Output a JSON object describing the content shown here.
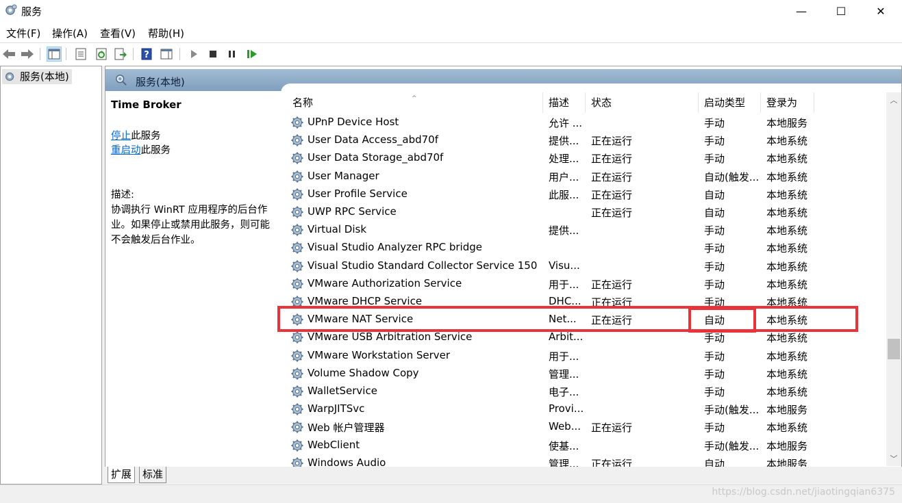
{
  "window": {
    "title": "服务",
    "minimize": "—",
    "maximize": "☐",
    "close": "✕"
  },
  "menu": [
    "文件(F)",
    "操作(A)",
    "查看(V)",
    "帮助(H)"
  ],
  "toolbar": [
    "back-arrow-icon",
    "forward-arrow-icon",
    "show-hide-tree-icon",
    "properties-icon",
    "refresh-icon",
    "export-list-icon",
    "help-icon",
    "action-pane-icon",
    "start-service-icon",
    "stop-service-icon",
    "pause-service-icon",
    "restart-service-icon"
  ],
  "tree": {
    "root": "服务(本地)"
  },
  "header": {
    "title": "服务(本地)"
  },
  "detail": {
    "service_name": "Time Broker",
    "stop_link": "停止",
    "stop_suffix": "此服务",
    "restart_link": "重启动",
    "restart_suffix": "此服务",
    "desc_label": "描述:",
    "desc_lines": [
      "协调执行 WinRT 应用程序的后台作",
      "业。如果停止或禁用此服务，则可能",
      "不会触发后台作业。"
    ]
  },
  "columns": {
    "name": "名称",
    "desc": "描述",
    "status": "状态",
    "startup": "启动类型",
    "logon": "登录为"
  },
  "services": [
    {
      "name": "UPnP Device Host",
      "desc": "允许 ...",
      "status": "",
      "startup": "手动",
      "logon": "本地服务"
    },
    {
      "name": "User Data Access_abd70f",
      "desc": "提供...",
      "status": "正在运行",
      "startup": "手动",
      "logon": "本地系统"
    },
    {
      "name": "User Data Storage_abd70f",
      "desc": "处理...",
      "status": "正在运行",
      "startup": "手动",
      "logon": "本地系统"
    },
    {
      "name": "User Manager",
      "desc": "用户...",
      "status": "正在运行",
      "startup": "自动(触发...",
      "logon": "本地系统"
    },
    {
      "name": "User Profile Service",
      "desc": "此服...",
      "status": "正在运行",
      "startup": "自动",
      "logon": "本地系统"
    },
    {
      "name": "UWP RPC Service",
      "desc": "",
      "status": "正在运行",
      "startup": "自动",
      "logon": "本地系统"
    },
    {
      "name": "Virtual Disk",
      "desc": "提供...",
      "status": "",
      "startup": "手动",
      "logon": "本地系统"
    },
    {
      "name": "Visual Studio Analyzer RPC bridge",
      "desc": "",
      "status": "",
      "startup": "手动",
      "logon": "本地系统"
    },
    {
      "name": "Visual Studio Standard Collector Service 150",
      "desc": "Visu...",
      "status": "",
      "startup": "手动",
      "logon": "本地系统"
    },
    {
      "name": "VMware Authorization Service",
      "desc": "用于...",
      "status": "正在运行",
      "startup": "手动",
      "logon": "本地系统"
    },
    {
      "name": "VMware DHCP Service",
      "desc": "DHC...",
      "status": "正在运行",
      "startup": "手动",
      "logon": "本地系统"
    },
    {
      "name": "VMware NAT Service",
      "desc": "Net...",
      "status": "正在运行",
      "startup": "自动",
      "logon": "本地系统"
    },
    {
      "name": "VMware USB Arbitration Service",
      "desc": "Arbit...",
      "status": "",
      "startup": "手动",
      "logon": "本地系统"
    },
    {
      "name": "VMware Workstation Server",
      "desc": "用于...",
      "status": "",
      "startup": "手动",
      "logon": "本地系统"
    },
    {
      "name": "Volume Shadow Copy",
      "desc": "管理...",
      "status": "",
      "startup": "手动",
      "logon": "本地系统"
    },
    {
      "name": "WalletService",
      "desc": "电子...",
      "status": "",
      "startup": "手动",
      "logon": "本地系统"
    },
    {
      "name": "WarpJITSvc",
      "desc": "Provi...",
      "status": "",
      "startup": "手动(触发...",
      "logon": "本地服务"
    },
    {
      "name": "Web 帐户管理器",
      "desc": "Web...",
      "status": "正在运行",
      "startup": "手动",
      "logon": "本地系统"
    },
    {
      "name": "WebClient",
      "desc": "使基...",
      "status": "",
      "startup": "手动(触发...",
      "logon": "本地服务"
    },
    {
      "name": "Windows Audio",
      "desc": "管理...",
      "status": "正在运行",
      "startup": "自动",
      "logon": "本地服务"
    }
  ],
  "tabs": [
    "扩展",
    "标准"
  ],
  "watermark": "https://blog.csdn.net/jiaotingqian6375",
  "colors": {
    "highlight": "#e8333a",
    "header_bar": "#8fadc9",
    "link": "#0066cc"
  }
}
